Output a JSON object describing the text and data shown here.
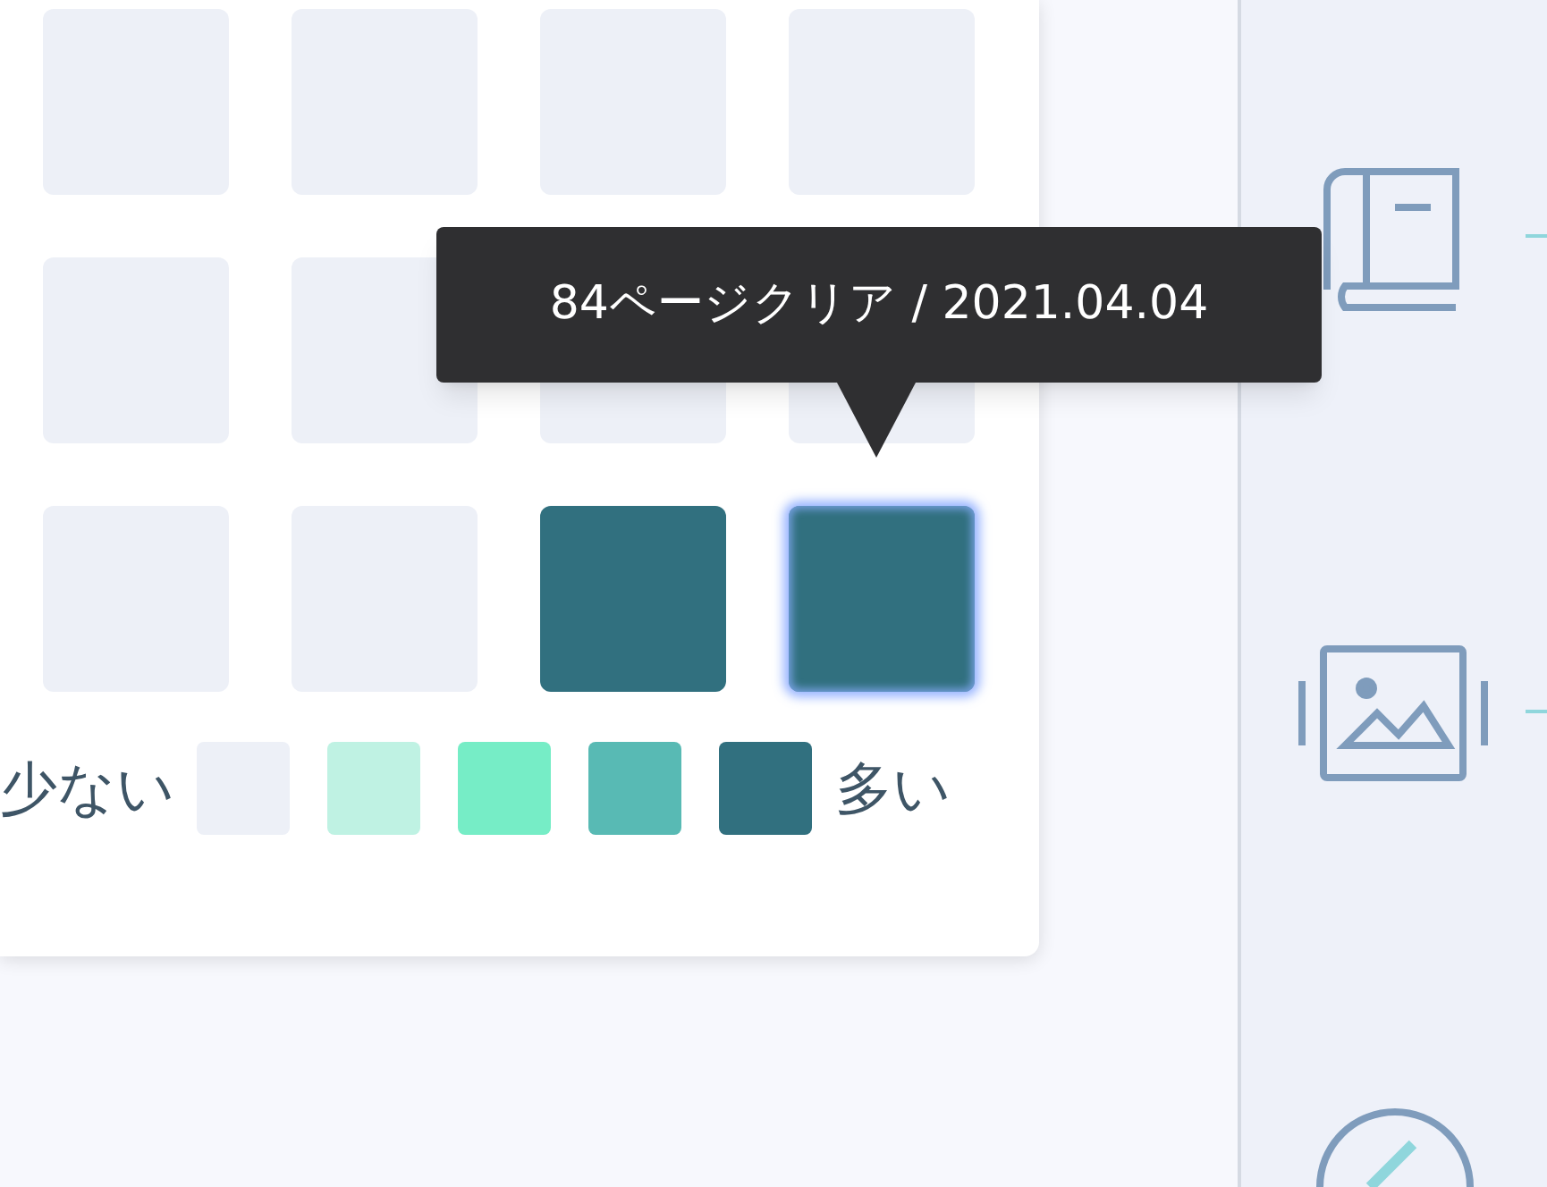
{
  "heatmap": {
    "cells": [
      {
        "color": "#edf0f7",
        "selected": false
      },
      {
        "color": "#edf0f7",
        "selected": false
      },
      {
        "color": "#edf0f7",
        "selected": false
      },
      {
        "color": "#edf0f7",
        "selected": false
      },
      {
        "color": "#edf0f7",
        "selected": false
      },
      {
        "color": "#edf0f7",
        "selected": false
      },
      {
        "color": "#edf0f7",
        "selected": false
      },
      {
        "color": "#edf0f7",
        "selected": false
      },
      {
        "color": "#edf0f7",
        "selected": false
      },
      {
        "color": "#edf0f7",
        "selected": false
      },
      {
        "color": "#31707f",
        "selected": false
      },
      {
        "color": "#31707f",
        "selected": true
      }
    ],
    "tooltip": "84ページクリア / 2021.04.04",
    "legend": {
      "low_label": "少ない",
      "high_label": "多い",
      "swatches": [
        {
          "color": "#edf0f7"
        },
        {
          "color": "#bff2e3"
        },
        {
          "color": "#76edc6"
        },
        {
          "color": "#58bab4"
        },
        {
          "color": "#31707f"
        }
      ]
    }
  }
}
